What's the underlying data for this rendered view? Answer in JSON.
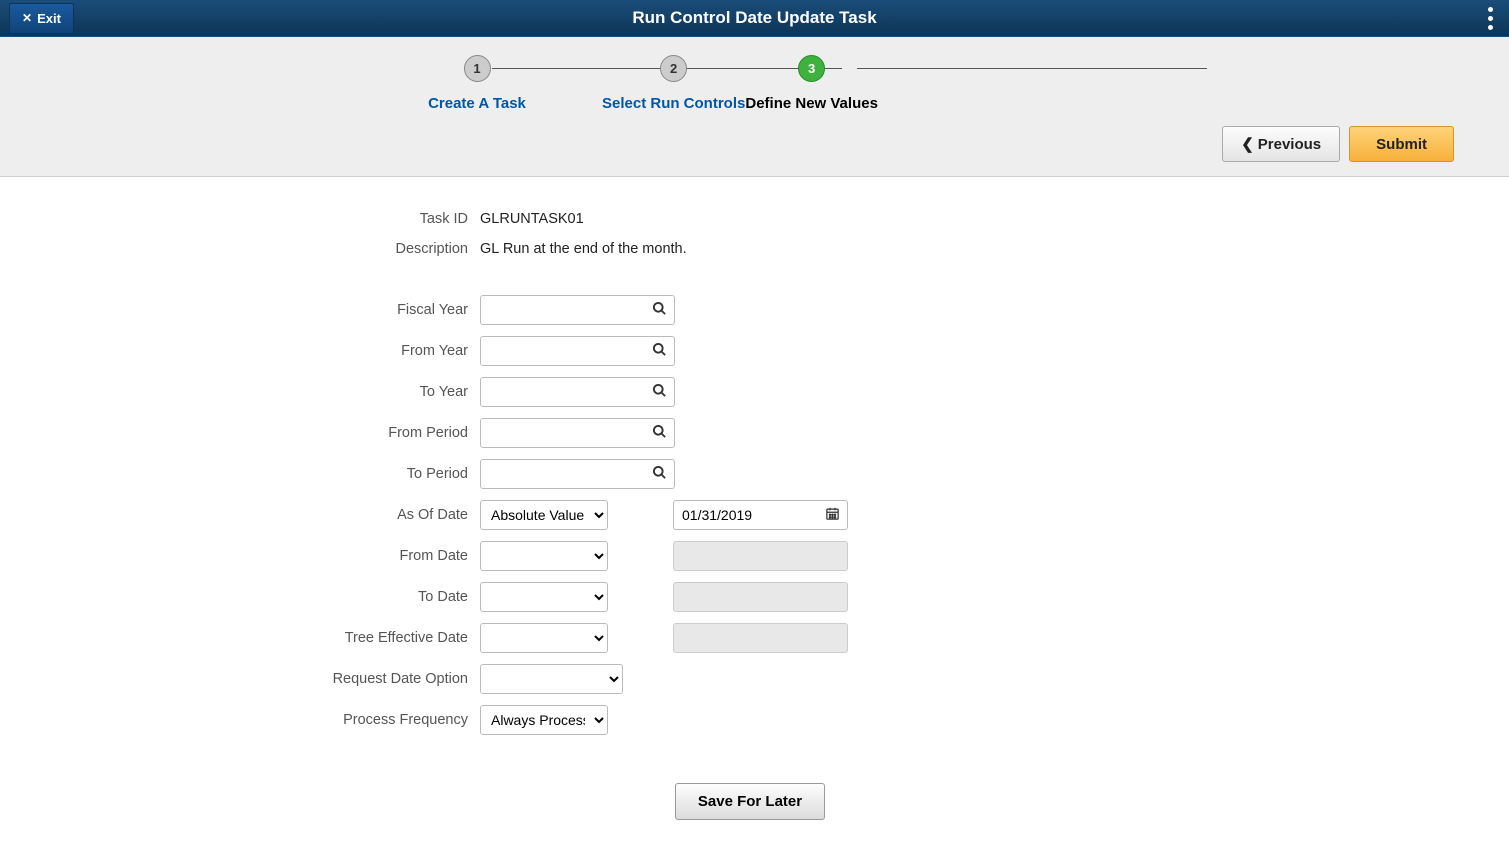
{
  "header": {
    "exit_label": "Exit",
    "title": "Run Control Date Update Task"
  },
  "wizard": {
    "steps": [
      {
        "num": "1",
        "label": "Create A Task"
      },
      {
        "num": "2",
        "label": "Select Run Controls"
      },
      {
        "num": "3",
        "label": "Define New Values"
      }
    ],
    "previous_label": "Previous",
    "submit_label": "Submit"
  },
  "form": {
    "task_id": {
      "label": "Task ID",
      "value": "GLRUNTASK01"
    },
    "description": {
      "label": "Description",
      "value": "GL Run at the end of the month."
    },
    "fiscal_year": {
      "label": "Fiscal Year",
      "value": ""
    },
    "from_year": {
      "label": "From Year",
      "value": ""
    },
    "to_year": {
      "label": "To Year",
      "value": ""
    },
    "from_period": {
      "label": "From Period",
      "value": ""
    },
    "to_period": {
      "label": "To Period",
      "value": ""
    },
    "as_of_date": {
      "label": "As Of Date",
      "select_value": "Absolute Value",
      "date_value": "01/31/2019"
    },
    "from_date": {
      "label": "From Date",
      "select_value": "",
      "date_value": ""
    },
    "to_date": {
      "label": "To Date",
      "select_value": "",
      "date_value": ""
    },
    "tree_eff_date": {
      "label": "Tree Effective Date",
      "select_value": "",
      "date_value": ""
    },
    "request_date_option": {
      "label": "Request Date Option",
      "select_value": ""
    },
    "process_frequency": {
      "label": "Process Frequency",
      "select_value": "Always Process"
    },
    "save_for_later_label": "Save For Later"
  }
}
